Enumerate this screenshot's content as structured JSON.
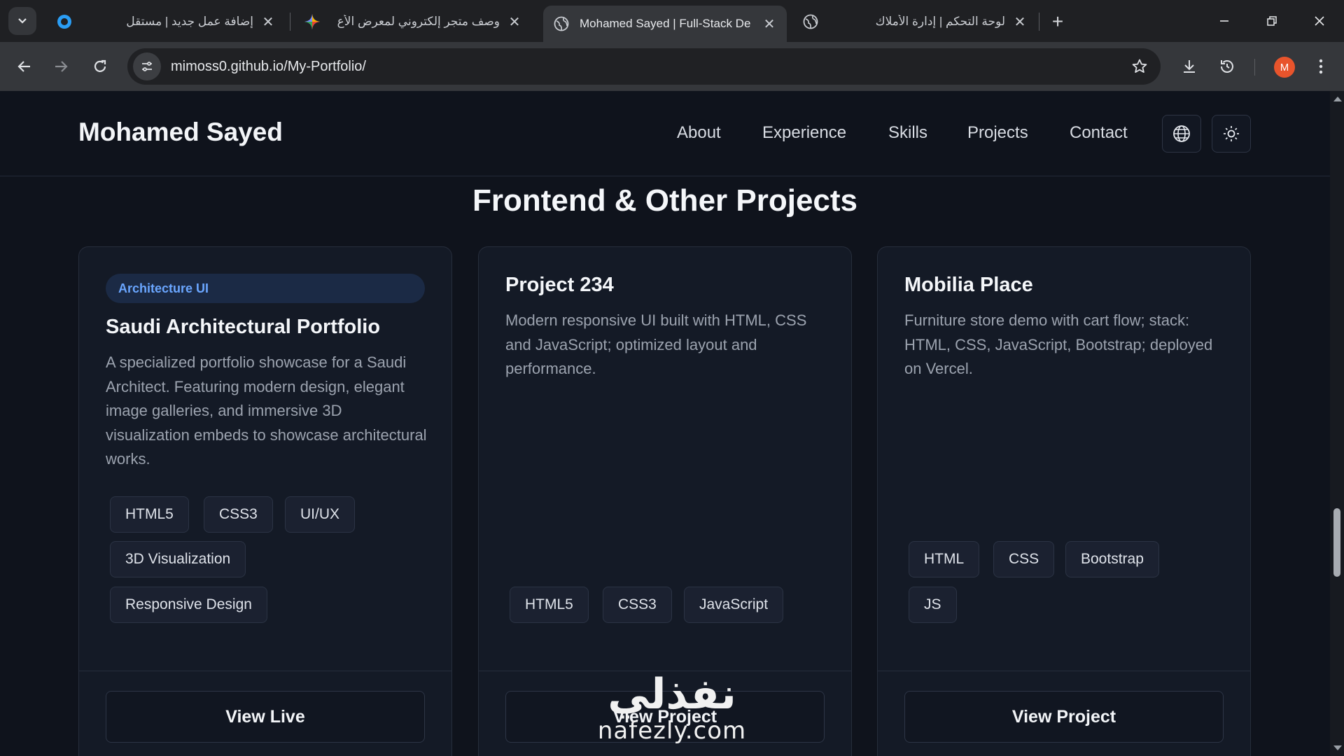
{
  "browser": {
    "tabs": [
      {
        "title": "إضافة عمل جديد | مستقل",
        "rtl": true
      },
      {
        "title": "وصف متجر إلكتروني لمعرض الأع",
        "rtl": true
      },
      {
        "title": "Mohamed Sayed | Full-Stack De",
        "rtl": false,
        "active": true
      },
      {
        "title": "لوحة التحكم | إدارة الأملاك",
        "rtl": true
      }
    ],
    "url": "mimoss0.github.io/My-Portfolio/",
    "profile_initial": "M"
  },
  "site": {
    "brand": "Mohamed Sayed",
    "nav": [
      "About",
      "Experience",
      "Skills",
      "Projects",
      "Contact"
    ],
    "section_title": "Frontend & Other Projects"
  },
  "projects": [
    {
      "badge": "Architecture UI",
      "title": "Saudi Architectural Portfolio",
      "description": "A specialized portfolio showcase for a Saudi Architect. Featuring modern design, elegant image galleries, and immersive 3D visualization embeds to showcase architectural works.",
      "tags": [
        "HTML5",
        "CSS3",
        "UI/UX",
        "3D Visualization",
        "Responsive Design"
      ],
      "button": "View Live"
    },
    {
      "title": "Project 234",
      "description": "Modern responsive UI built with HTML, CSS and JavaScript; optimized layout and performance.",
      "tags": [
        "HTML5",
        "CSS3",
        "JavaScript"
      ],
      "button": "View Project"
    },
    {
      "title": "Mobilia Place",
      "description": "Furniture store demo with cart flow; stack: HTML, CSS, JavaScript, Bootstrap; deployed on Vercel.",
      "tags": [
        "HTML",
        "CSS",
        "Bootstrap",
        "JS"
      ],
      "button": "View Project"
    }
  ],
  "watermark": {
    "arabic": "نفذلي",
    "latin": "nafezly.com"
  },
  "colors": {
    "page_bg": "#0f131c",
    "card_bg": "#141a26",
    "accent": "#6aa6ff",
    "profile": "#e8542c"
  }
}
